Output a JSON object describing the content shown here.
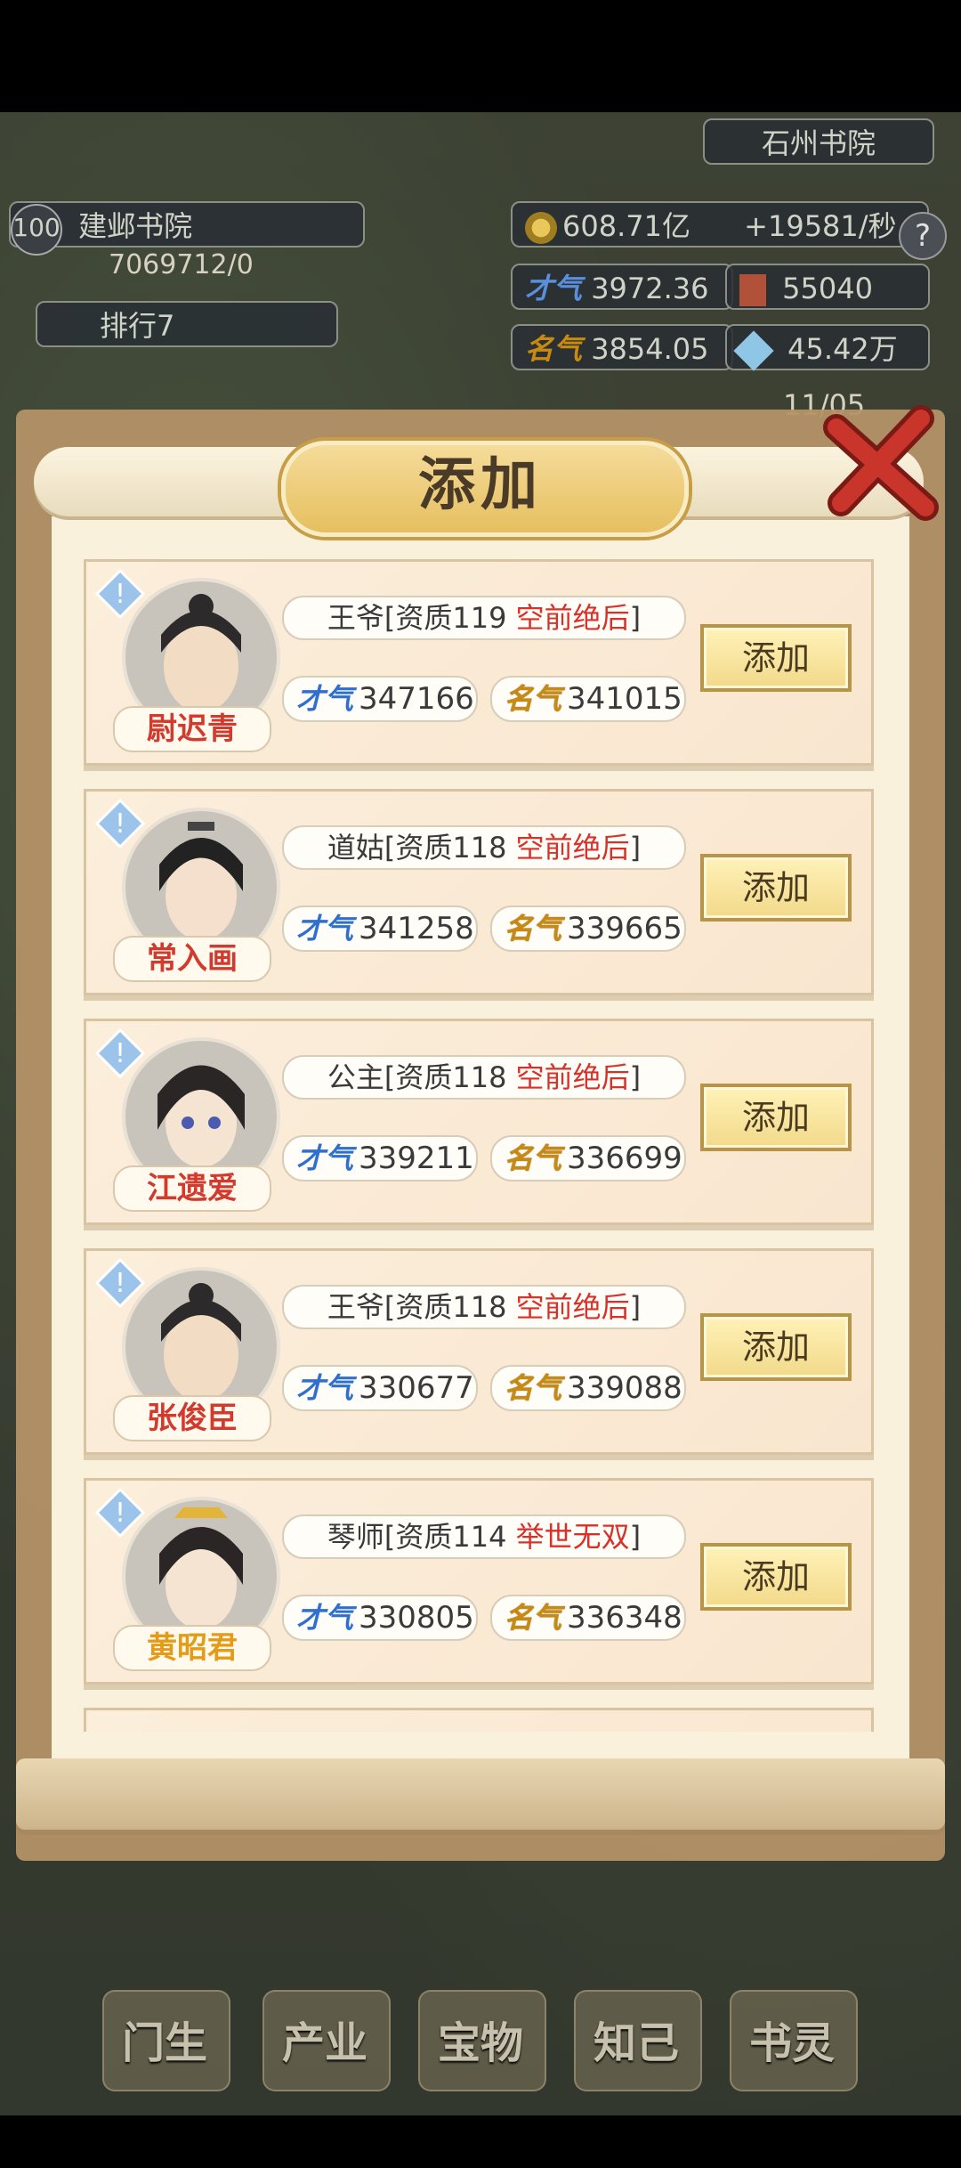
{
  "hud": {
    "level": "100",
    "academy_name": "建邺书院",
    "exp": "7069712/0",
    "rank": "排行7",
    "rival_academy": "石州书院",
    "gold": "608.71亿",
    "gold_rate": "+19581/秒",
    "talent_label": "才气",
    "talent": "3972.36",
    "books": "55040",
    "fame_label": "名气",
    "fame": "3854.05",
    "gems": "45.42万",
    "partial_counter": "11/05"
  },
  "modal": {
    "title": "添加",
    "close_icon": "close-x-icon"
  },
  "candidates": [
    {
      "name": "尉迟青",
      "role": "王爷",
      "aptitude_prefix": "[资质119",
      "quality": "空前绝后",
      "aptitude_suffix": "]",
      "talent_label": "才气",
      "talent": "347166",
      "fame_label": "名气",
      "fame": "341015",
      "button": "添加",
      "name_color": "red"
    },
    {
      "name": "常入画",
      "role": "道姑",
      "aptitude_prefix": "[资质118",
      "quality": "空前绝后",
      "aptitude_suffix": "]",
      "talent_label": "才气",
      "talent": "341258",
      "fame_label": "名气",
      "fame": "339665",
      "button": "添加",
      "name_color": "red"
    },
    {
      "name": "江遗爱",
      "role": "公主",
      "aptitude_prefix": "[资质118",
      "quality": "空前绝后",
      "aptitude_suffix": "]",
      "talent_label": "才气",
      "talent": "339211",
      "fame_label": "名气",
      "fame": "336699",
      "button": "添加",
      "name_color": "red"
    },
    {
      "name": "张俊臣",
      "role": "王爷",
      "aptitude_prefix": "[资质118",
      "quality": "空前绝后",
      "aptitude_suffix": "]",
      "talent_label": "才气",
      "talent": "330677",
      "fame_label": "名气",
      "fame": "339088",
      "button": "添加",
      "name_color": "red"
    },
    {
      "name": "黄昭君",
      "role": "琴师",
      "aptitude_prefix": "[资质114",
      "quality": "举世无双",
      "aptitude_suffix": "]",
      "talent_label": "才气",
      "talent": "330805",
      "fame_label": "名气",
      "fame": "336348",
      "button": "添加",
      "name_color": "gold"
    }
  ],
  "bottom_nav": [
    "门生",
    "产业",
    "宝物",
    "知己",
    "书灵"
  ],
  "colors": {
    "accent_red": "#d8312a",
    "talent_blue": "#2f6fd0",
    "fame_gold": "#c98a10",
    "paper": "#faf1dd"
  }
}
